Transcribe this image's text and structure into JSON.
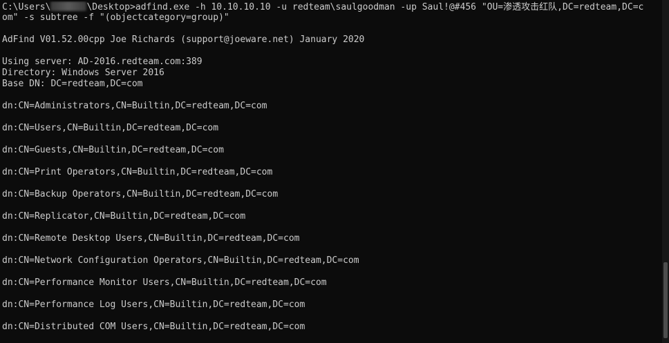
{
  "prompt": {
    "path_prefix": "C:\\Users\\",
    "path_suffix": "\\Desktop>",
    "command_part1": "adfind.exe -h 10.10.10.10 -u redteam\\saulgoodman -up Saul!@#456 \"OU=渗透攻击红队,DC=redteam,DC=c",
    "command_part2": "om\" -s subtree -f \"(objectcategory=group)\""
  },
  "header": {
    "banner": "AdFind V01.52.00cpp Joe Richards (support@joeware.net) January 2020",
    "server": "Using server: AD-2016.redteam.com:389",
    "directory": "Directory: Windows Server 2016",
    "base_dn": "Base DN: DC=redteam,DC=com"
  },
  "results": [
    "dn:CN=Administrators,CN=Builtin,DC=redteam,DC=com",
    "dn:CN=Users,CN=Builtin,DC=redteam,DC=com",
    "dn:CN=Guests,CN=Builtin,DC=redteam,DC=com",
    "dn:CN=Print Operators,CN=Builtin,DC=redteam,DC=com",
    "dn:CN=Backup Operators,CN=Builtin,DC=redteam,DC=com",
    "dn:CN=Replicator,CN=Builtin,DC=redteam,DC=com",
    "dn:CN=Remote Desktop Users,CN=Builtin,DC=redteam,DC=com",
    "dn:CN=Network Configuration Operators,CN=Builtin,DC=redteam,DC=com",
    "dn:CN=Performance Monitor Users,CN=Builtin,DC=redteam,DC=com",
    "dn:CN=Performance Log Users,CN=Builtin,DC=redteam,DC=com",
    "dn:CN=Distributed COM Users,CN=Builtin,DC=redteam,DC=com"
  ],
  "colors": {
    "background": "#0c0c0c",
    "text": "#cccccc"
  }
}
